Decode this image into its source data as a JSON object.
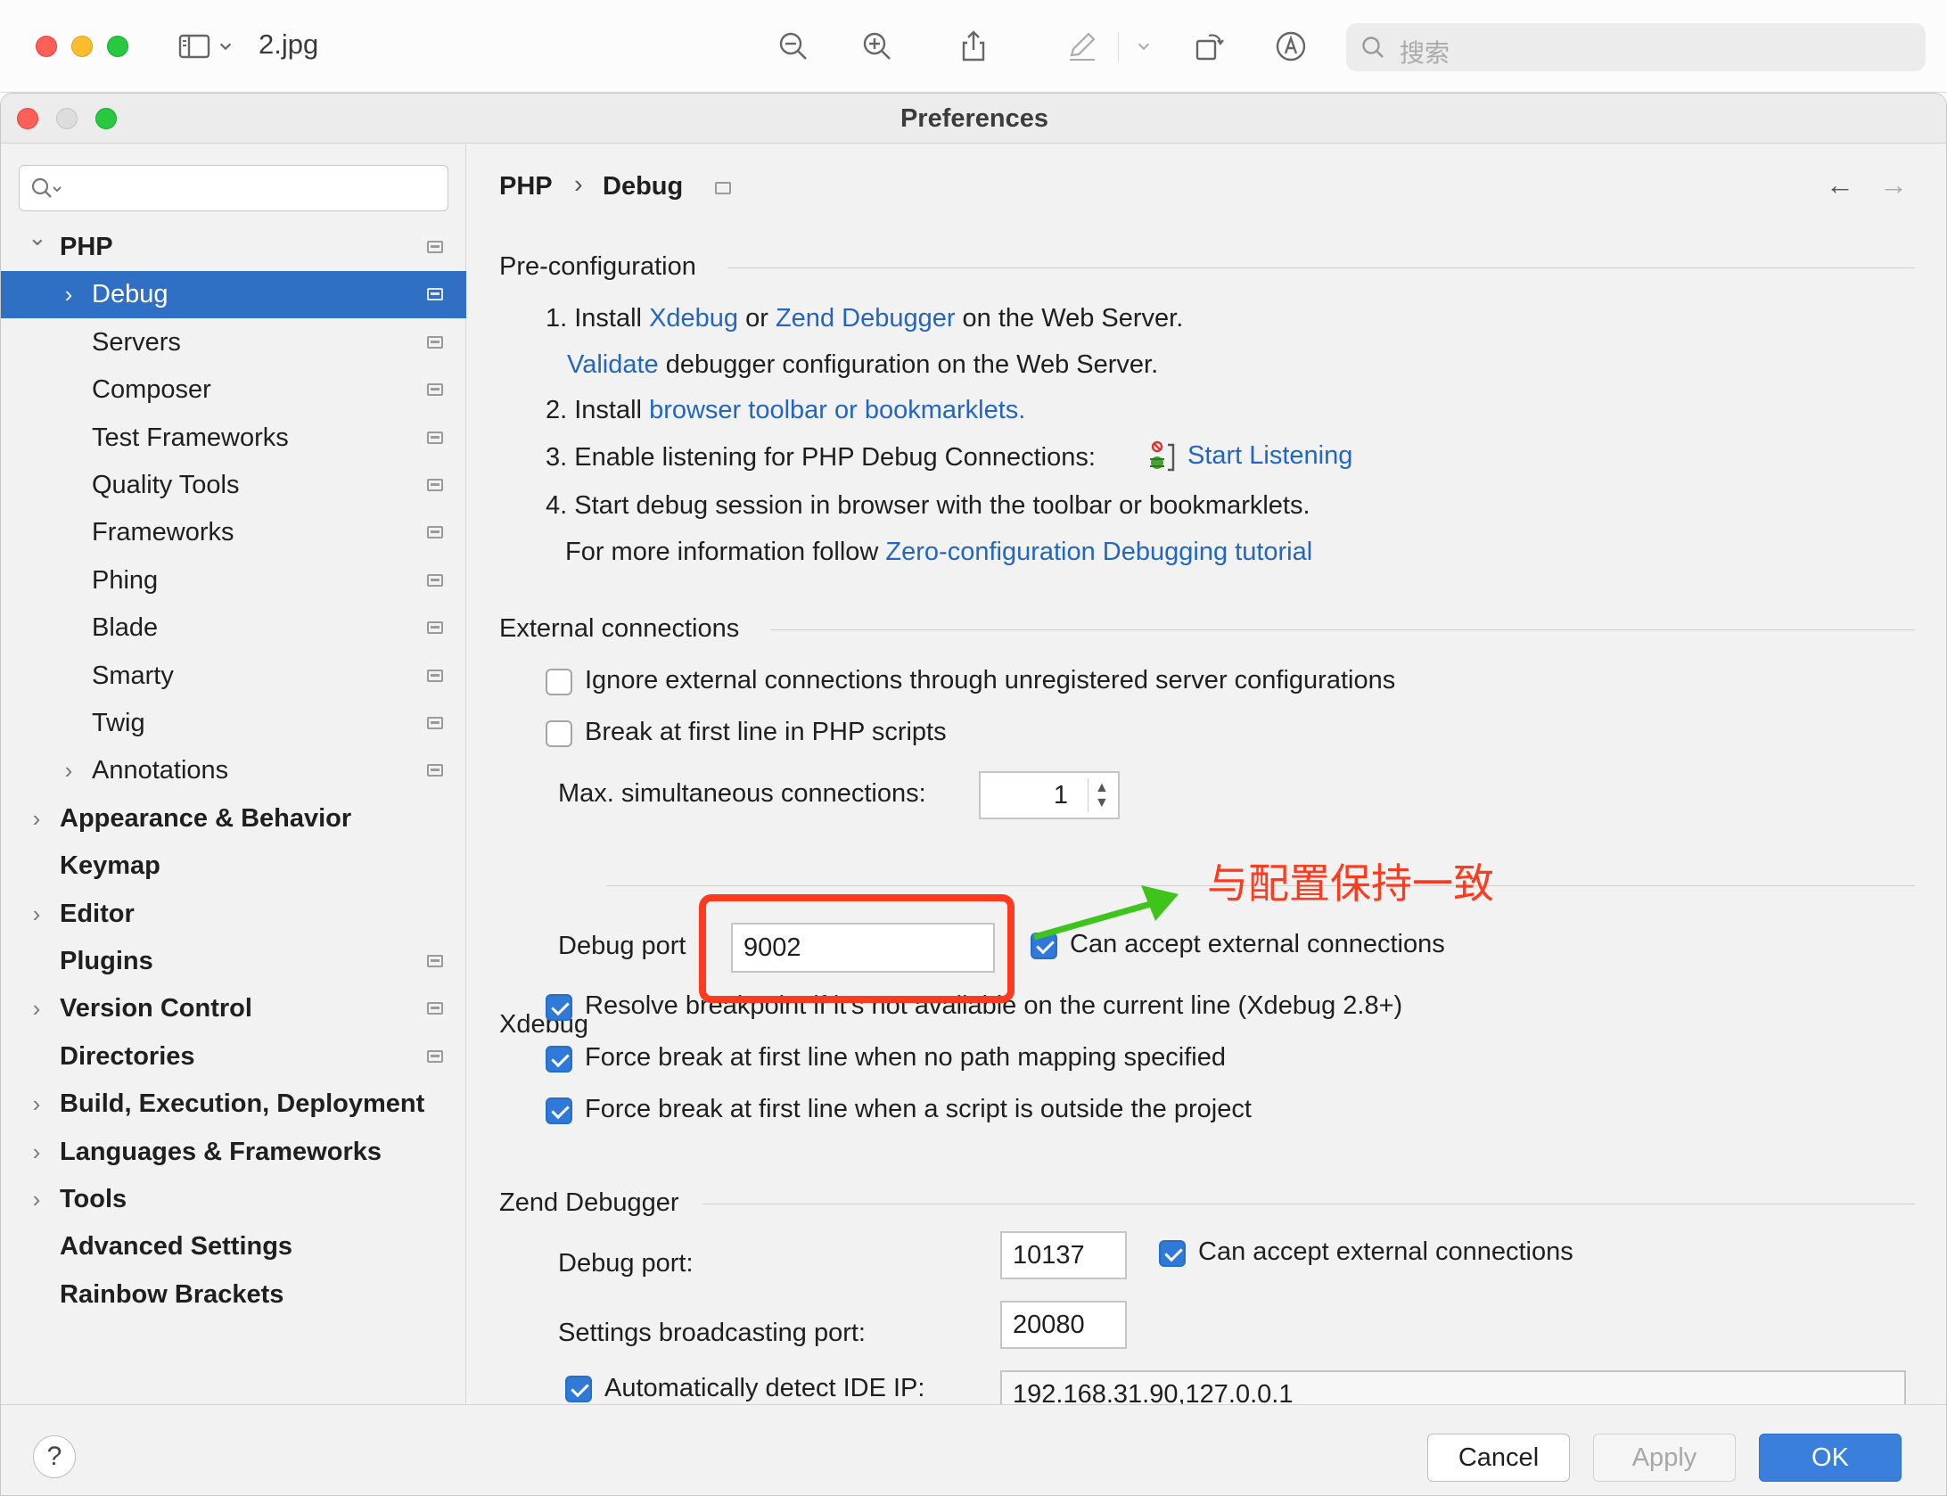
{
  "preview": {
    "filename": "2.jpg",
    "search_placeholder": "搜索",
    "icons": [
      "sidebar-icon",
      "zoom-out-icon",
      "zoom-in-icon",
      "share-icon",
      "markup-icon",
      "rotate-icon",
      "annotate-icon"
    ]
  },
  "window": {
    "title": "Preferences"
  },
  "sidebar": {
    "items": [
      {
        "label": "PHP",
        "bold": true,
        "level": 0,
        "expander": "open",
        "settings_icon": true
      },
      {
        "label": "Debug",
        "bold": false,
        "level": 1,
        "expander": "closed",
        "settings_icon": true,
        "selected": true
      },
      {
        "label": "Servers",
        "bold": false,
        "level": 1,
        "expander": "none",
        "settings_icon": true
      },
      {
        "label": "Composer",
        "bold": false,
        "level": 1,
        "expander": "none",
        "settings_icon": true
      },
      {
        "label": "Test Frameworks",
        "bold": false,
        "level": 1,
        "expander": "none",
        "settings_icon": true
      },
      {
        "label": "Quality Tools",
        "bold": false,
        "level": 1,
        "expander": "none",
        "settings_icon": true
      },
      {
        "label": "Frameworks",
        "bold": false,
        "level": 1,
        "expander": "none",
        "settings_icon": true
      },
      {
        "label": "Phing",
        "bold": false,
        "level": 1,
        "expander": "none",
        "settings_icon": true
      },
      {
        "label": "Blade",
        "bold": false,
        "level": 1,
        "expander": "none",
        "settings_icon": true
      },
      {
        "label": "Smarty",
        "bold": false,
        "level": 1,
        "expander": "none",
        "settings_icon": true
      },
      {
        "label": "Twig",
        "bold": false,
        "level": 1,
        "expander": "none",
        "settings_icon": true
      },
      {
        "label": "Annotations",
        "bold": false,
        "level": 1,
        "expander": "closed",
        "settings_icon": true
      },
      {
        "label": "Appearance & Behavior",
        "bold": true,
        "level": 0,
        "expander": "closed",
        "settings_icon": false
      },
      {
        "label": "Keymap",
        "bold": true,
        "level": 0,
        "expander": "none",
        "settings_icon": false
      },
      {
        "label": "Editor",
        "bold": true,
        "level": 0,
        "expander": "closed",
        "settings_icon": false
      },
      {
        "label": "Plugins",
        "bold": true,
        "level": 0,
        "expander": "none",
        "settings_icon": true
      },
      {
        "label": "Version Control",
        "bold": true,
        "level": 0,
        "expander": "closed",
        "settings_icon": true
      },
      {
        "label": "Directories",
        "bold": true,
        "level": 0,
        "expander": "none",
        "settings_icon": true
      },
      {
        "label": "Build, Execution, Deployment",
        "bold": true,
        "level": 0,
        "expander": "closed",
        "settings_icon": false
      },
      {
        "label": "Languages & Frameworks",
        "bold": true,
        "level": 0,
        "expander": "closed",
        "settings_icon": false
      },
      {
        "label": "Tools",
        "bold": true,
        "level": 0,
        "expander": "closed",
        "settings_icon": false
      },
      {
        "label": "Advanced Settings",
        "bold": true,
        "level": 0,
        "expander": "none",
        "settings_icon": false
      },
      {
        "label": "Rainbow Brackets",
        "bold": true,
        "level": 0,
        "expander": "none",
        "settings_icon": false
      }
    ]
  },
  "breadcrumb": {
    "parent": "PHP",
    "sep": "›",
    "current": "Debug"
  },
  "preconfig": {
    "title": "Pre-configuration",
    "step1_prefix": "1. Install ",
    "step1_link1": "Xdebug",
    "step1_or": " or ",
    "step1_link2": "Zend Debugger",
    "step1_suffix": " on the Web Server.",
    "validate_link": "Validate",
    "validate_suffix": " debugger configuration on the Web Server.",
    "step2_prefix": "2. Install ",
    "step2_link": "browser toolbar or bookmarklets.",
    "step3_text": "3. Enable listening for PHP Debug Connections:",
    "step3_link": "Start Listening",
    "step4_text": "4. Start debug session in browser with the toolbar or bookmarklets.",
    "more_prefix": "For more information follow ",
    "more_link": "Zero-configuration Debugging tutorial"
  },
  "external": {
    "title": "External connections",
    "ignore_label": "Ignore external connections through unregistered server configurations",
    "ignore_checked": false,
    "break_label": "Break at first line in PHP scripts",
    "break_checked": false,
    "max_label": "Max. simultaneous connections:",
    "max_value": "1"
  },
  "xdebug": {
    "title": "Xdebug",
    "port_label": "Debug port",
    "port_value": "9002",
    "accept_label": "Can accept external connections",
    "accept_checked": true,
    "resolve_label": "Resolve breakpoint if it's not available on the current line (Xdebug 2.8+)",
    "resolve_checked": true,
    "force1_label": "Force break at first line when no path mapping specified",
    "force1_checked": true,
    "force2_label": "Force break at first line when a script is outside the project",
    "force2_checked": true
  },
  "annotation": {
    "text": "与配置保持一致",
    "color": "#ff3b1f",
    "arrow_color": "#3ec41a"
  },
  "zend": {
    "title": "Zend Debugger",
    "port_label": "Debug port:",
    "port_value": "10137",
    "accept_label": "Can accept external connections",
    "accept_checked": true,
    "broadcast_label": "Settings broadcasting port:",
    "broadcast_value": "20080",
    "detect_label": "Automatically detect IDE IP:",
    "detect_checked": true,
    "detect_value": "192.168.31.90,127.0.0.1"
  },
  "footer": {
    "help": "?",
    "cancel": "Cancel",
    "apply": "Apply",
    "ok": "OK"
  },
  "colors": {
    "selection": "#2f6fc4",
    "link": "#2266c2",
    "ok_button": "#3a7fdc"
  }
}
